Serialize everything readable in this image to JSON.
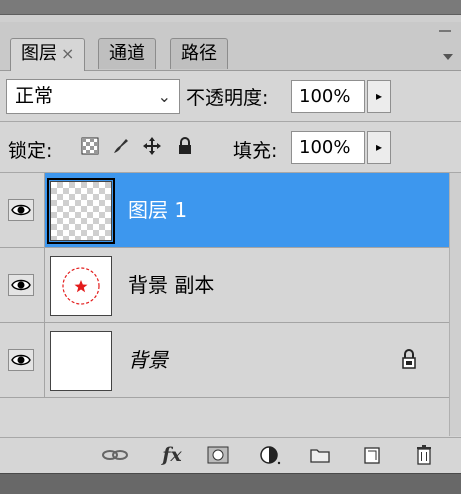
{
  "tabs": [
    {
      "label": "图层",
      "close": "×",
      "active": true
    },
    {
      "label": "通道",
      "active": false
    },
    {
      "label": "路径",
      "active": false
    }
  ],
  "blend_mode": {
    "value": "正常",
    "chevron": "⌄"
  },
  "opacity": {
    "label": "不透明度:",
    "value": "100%",
    "arrow": "▸"
  },
  "lock": {
    "label": "锁定:"
  },
  "fill": {
    "label": "填充:",
    "value": "100%",
    "arrow": "▸"
  },
  "layers": [
    {
      "name": "图层 1",
      "selected": true,
      "visible": true,
      "locked": false,
      "thumbnail": "transparent-checker"
    },
    {
      "name": "背景 副本",
      "selected": false,
      "visible": true,
      "locked": false,
      "thumbnail": "red-circle-star"
    },
    {
      "name": "背景",
      "selected": false,
      "visible": true,
      "locked": true,
      "thumbnail": "blank-white"
    }
  ],
  "footer": {
    "fx_label": "fx",
    "icons": [
      "link-icon",
      "fx-icon",
      "layer-mask-icon",
      "adjustment-layer-icon",
      "group-folder-icon",
      "new-layer-icon",
      "trash-icon"
    ]
  },
  "colors": {
    "selection": "#3d97ee",
    "panel": "#d6d6d6",
    "star": "#e31b1b"
  }
}
